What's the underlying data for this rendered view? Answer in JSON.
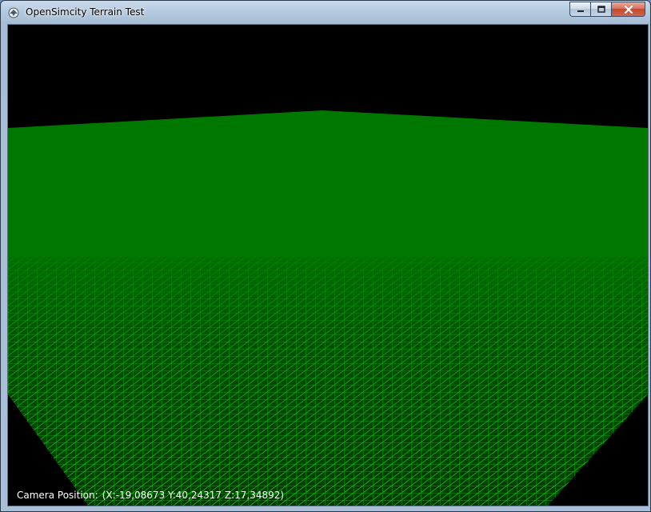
{
  "window": {
    "title": "OpenSimcity Terrain Test",
    "app_icon": "opensimcity-app-icon",
    "buttons": {
      "minimize_icon": "minimize-icon",
      "maximize_icon": "maximize-icon",
      "close_icon": "close-icon"
    }
  },
  "viewport": {
    "background_color": "#000000",
    "terrain_fill_color": "#007800",
    "wireframe_color": "#11c411",
    "overlay": {
      "label": "Camera Position:",
      "coordinates": "(X:-19,08673 Y:40,24317 Z:17,34892)"
    }
  }
}
